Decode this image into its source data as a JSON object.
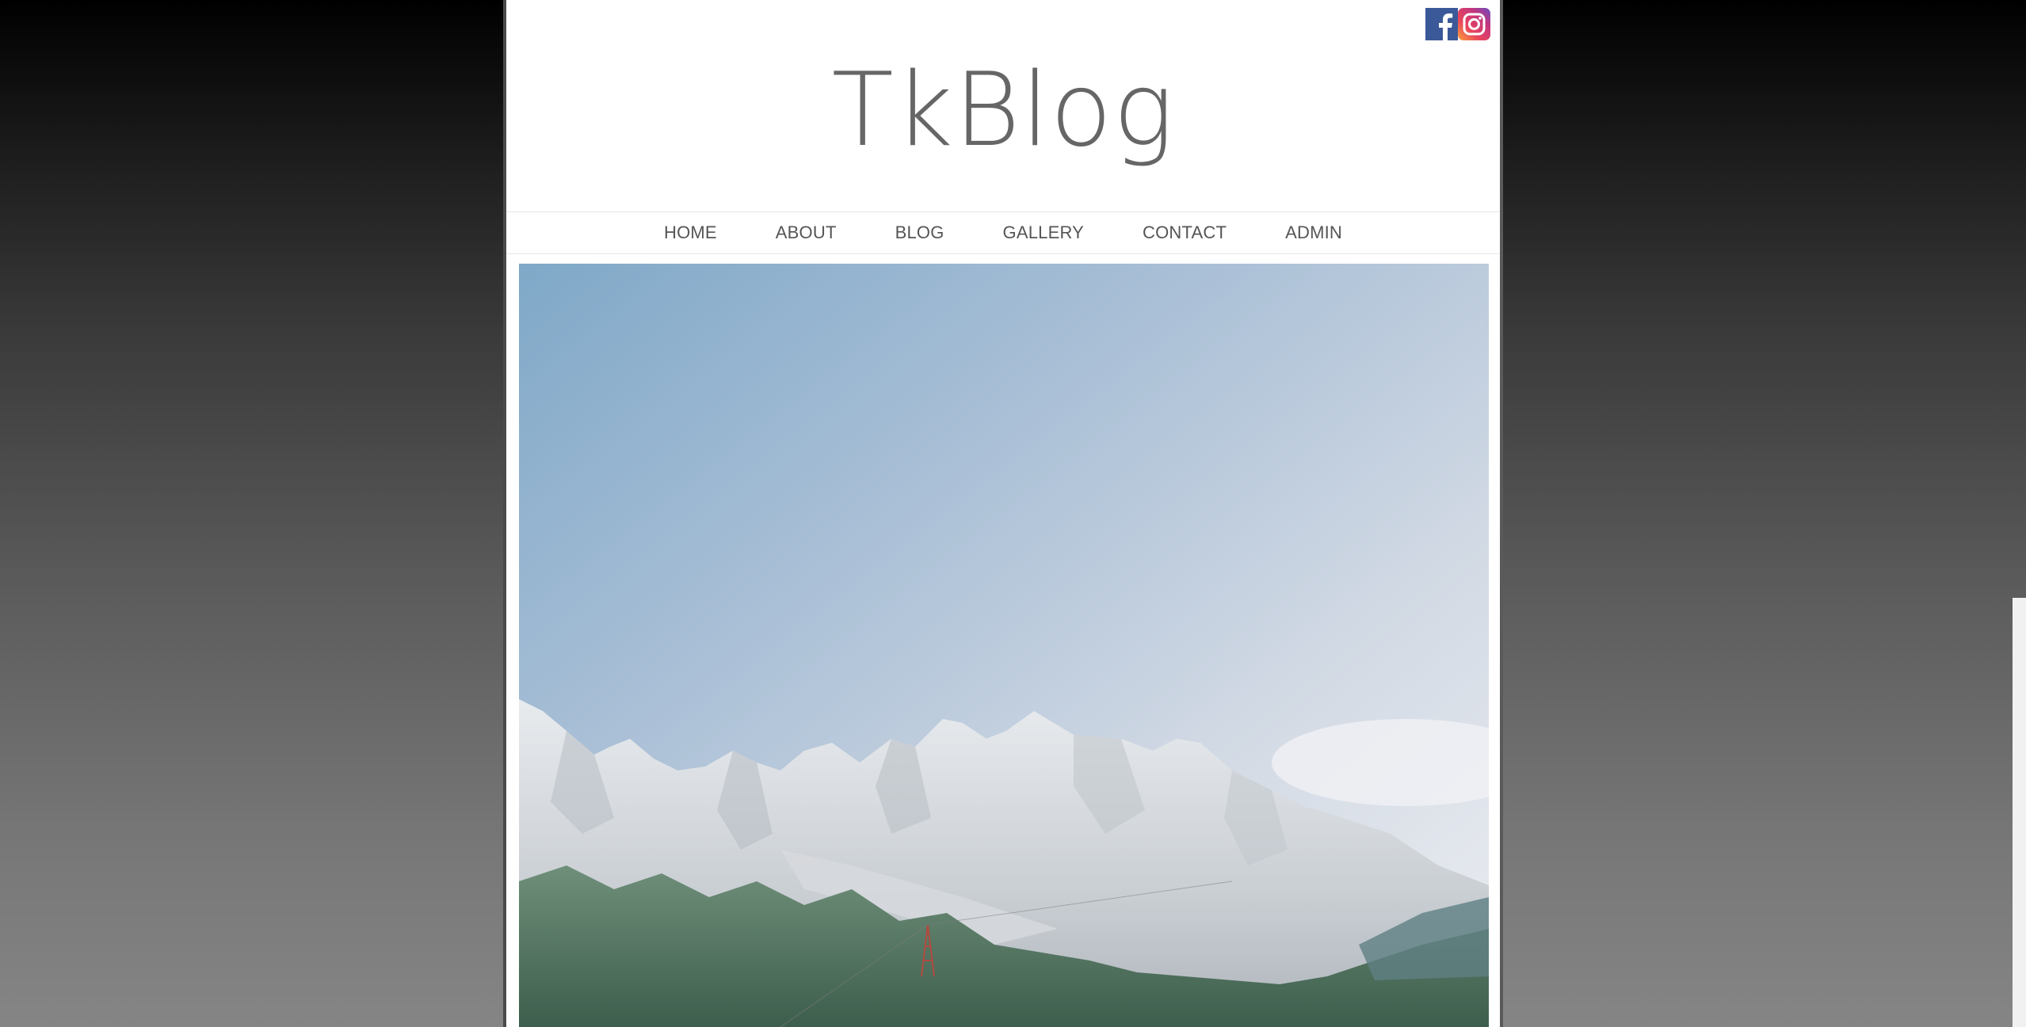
{
  "site": {
    "title": "TkBlog"
  },
  "social": {
    "facebook_icon": "facebook-icon",
    "instagram_icon": "instagram-icon"
  },
  "nav": {
    "items": [
      {
        "label": "HOME"
      },
      {
        "label": "ABOUT"
      },
      {
        "label": "BLOG"
      },
      {
        "label": "GALLERY"
      },
      {
        "label": "CONTACT"
      },
      {
        "label": "ADMIN"
      }
    ]
  },
  "hero": {
    "image": "mountain-landscape"
  },
  "colors": {
    "logo_text": "#666666",
    "nav_text": "#555555",
    "facebook": "#3b5998",
    "page_bg": "#ffffff"
  }
}
